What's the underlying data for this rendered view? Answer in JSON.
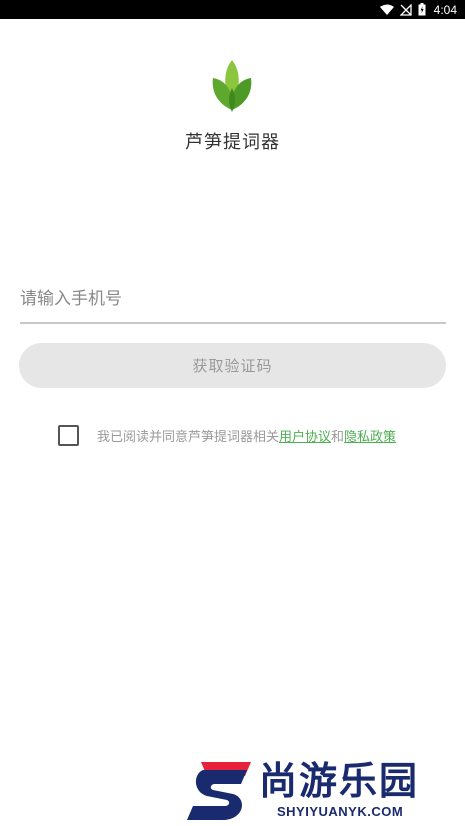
{
  "status_bar": {
    "time": "4:04",
    "icons": [
      "wifi-icon",
      "no-signal-icon",
      "battery-icon"
    ]
  },
  "app": {
    "title": "芦笋提词器",
    "logo_icon": "leaf-logo-icon"
  },
  "login": {
    "phone_placeholder": "请输入手机号",
    "phone_value": "",
    "get_code_label": "获取验证码"
  },
  "agreement": {
    "checked": false,
    "prefix": "我已阅读并同意芦笋提词器相关",
    "user_agreement": "用户协议",
    "conjunction": "和",
    "privacy_policy": "隐私政策"
  },
  "watermark": {
    "cn": "尚游乐园",
    "en": "SHYIYUANYK.COM"
  },
  "colors": {
    "accent_green": "#4caf50",
    "logo_green": "#7cbd3f",
    "button_bg": "#e6e6e6",
    "watermark_blue": "#1a2a6e",
    "watermark_red": "#e8213a"
  }
}
